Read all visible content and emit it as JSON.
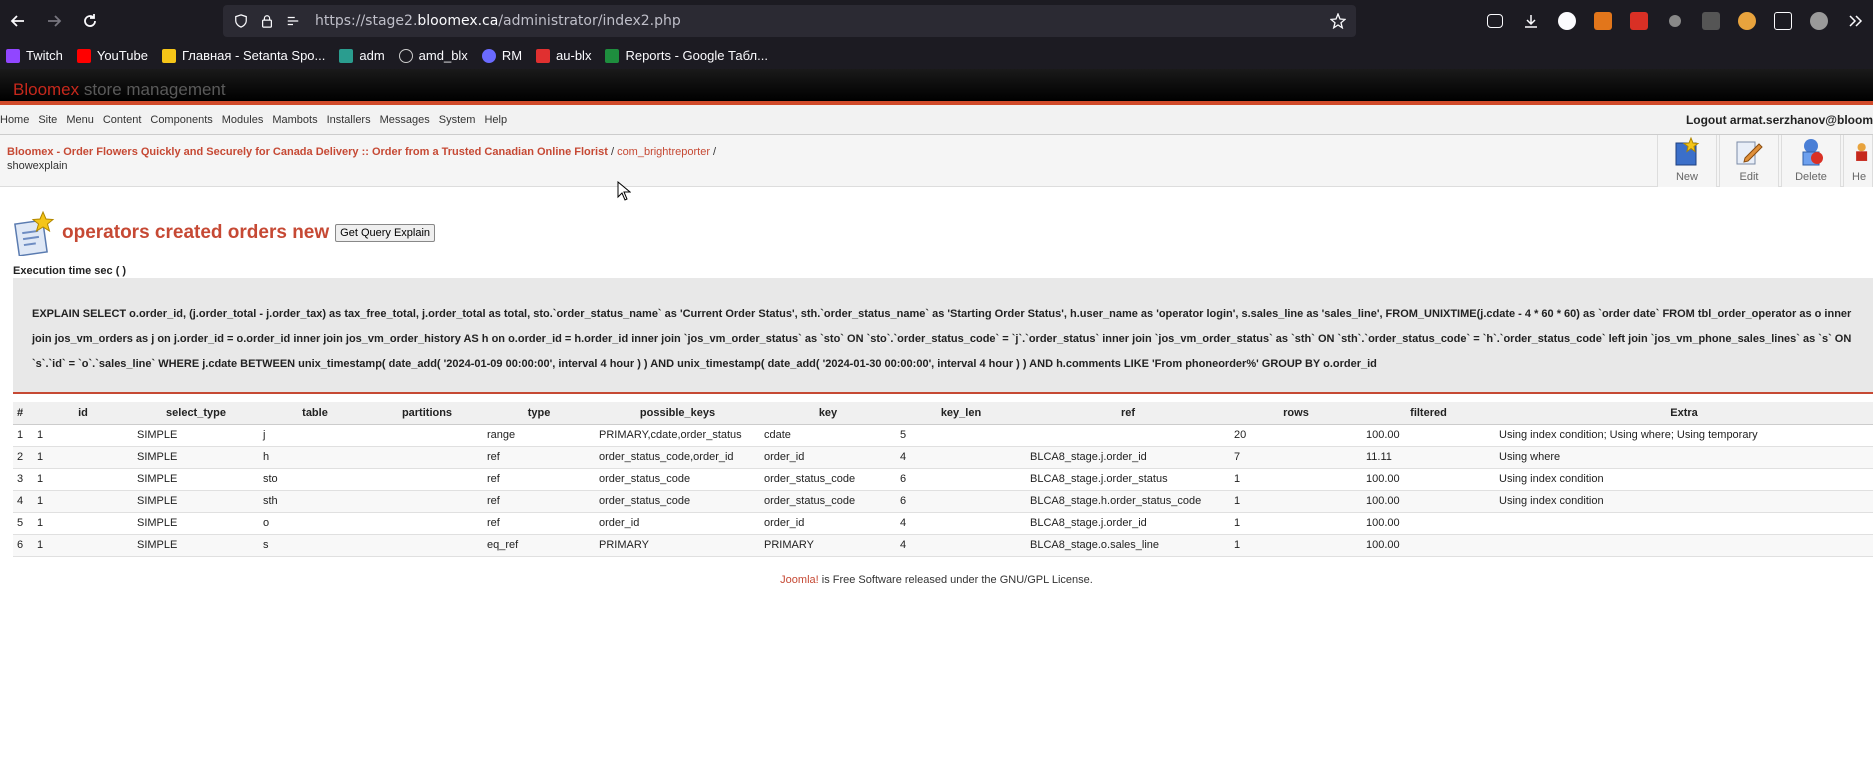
{
  "browser": {
    "url_prefix": "https://stage2.",
    "url_domain": "bloomex.ca",
    "url_path": "/administrator/index2.php",
    "bookmarks": [
      {
        "label": "Twitch",
        "color": "#9146ff"
      },
      {
        "label": "YouTube",
        "color": "#ff0000"
      },
      {
        "label": "Главная - Setanta Spo...",
        "color": "#f5c518"
      },
      {
        "label": "adm",
        "color": "#2a9d8f"
      },
      {
        "label": "amd_blx",
        "color": "#bbbbbb"
      },
      {
        "label": "RM",
        "color": "#6a6aff"
      },
      {
        "label": "au-blx",
        "color": "#e03030"
      },
      {
        "label": "Reports - Google Табл...",
        "color": "#1e8e3e"
      }
    ]
  },
  "header": {
    "logo_brand": "Bloomex",
    "logo_suffix": " store management"
  },
  "menu": {
    "items": [
      "Home",
      "Site",
      "Menu",
      "Content",
      "Components",
      "Modules",
      "Mambots",
      "Installers",
      "Messages",
      "System",
      "Help"
    ],
    "logout": "Logout armat.serzhanov@bloom"
  },
  "pathway": {
    "site_title": "Bloomex - Order Flowers Quickly and Securely for Canada Delivery :: Order from a Trusted Canadian Online Florist",
    "sep1": " / ",
    "component": "com_brightreporter",
    "sep2": " /",
    "task": "showexplain"
  },
  "toolbar": {
    "buttons": [
      "New",
      "Edit",
      "Delete",
      "He"
    ]
  },
  "page": {
    "title": "operators created orders new",
    "explain_button": "Get Query Explain",
    "execution_label": "Execution time sec ( )",
    "query": "EXPLAIN SELECT o.order_id, (j.order_total - j.order_tax) as tax_free_total, j.order_total as total, sto.`order_status_name` as 'Current Order Status', sth.`order_status_name` as 'Starting Order Status', h.user_name as 'operator login', s.sales_line as 'sales_line', FROM_UNIXTIME(j.cdate - 4 * 60 * 60) as `order date` FROM tbl_order_operator as o inner join jos_vm_orders as j on j.order_id = o.order_id inner join jos_vm_order_history AS h on o.order_id = h.order_id inner join `jos_vm_order_status` as `sto` ON `sto`.`order_status_code` = `j`.`order_status` inner join `jos_vm_order_status` as `sth` ON `sth`.`order_status_code` = `h`.`order_status_code` left join `jos_vm_phone_sales_lines` as `s` ON `s`.`id` = `o`.`sales_line` WHERE j.cdate BETWEEN unix_timestamp( date_add( '2024-01-09 00:00:00', interval 4 hour ) ) AND unix_timestamp( date_add( '2024-01-30 00:00:00', interval 4 hour ) ) AND h.comments LIKE 'From phoneorder%' GROUP BY o.order_id"
  },
  "table": {
    "headers": [
      "#",
      "id",
      "select_type",
      "table",
      "partitions",
      "type",
      "possible_keys",
      "key",
      "key_len",
      "ref",
      "rows",
      "filtered",
      "Extra"
    ],
    "rows": [
      [
        "1",
        "1",
        "SIMPLE",
        "j",
        "",
        "range",
        "PRIMARY,cdate,order_status",
        "cdate",
        "5",
        "",
        "20",
        "100.00",
        "Using index condition; Using where; Using temporary"
      ],
      [
        "2",
        "1",
        "SIMPLE",
        "h",
        "",
        "ref",
        "order_status_code,order_id",
        "order_id",
        "4",
        "BLCA8_stage.j.order_id",
        "7",
        "11.11",
        "Using where"
      ],
      [
        "3",
        "1",
        "SIMPLE",
        "sto",
        "",
        "ref",
        "order_status_code",
        "order_status_code",
        "6",
        "BLCA8_stage.j.order_status",
        "1",
        "100.00",
        "Using index condition"
      ],
      [
        "4",
        "1",
        "SIMPLE",
        "sth",
        "",
        "ref",
        "order_status_code",
        "order_status_code",
        "6",
        "BLCA8_stage.h.order_status_code",
        "1",
        "100.00",
        "Using index condition"
      ],
      [
        "5",
        "1",
        "SIMPLE",
        "o",
        "",
        "ref",
        "order_id",
        "order_id",
        "4",
        "BLCA8_stage.j.order_id",
        "1",
        "100.00",
        ""
      ],
      [
        "6",
        "1",
        "SIMPLE",
        "s",
        "",
        "eq_ref",
        "PRIMARY",
        "PRIMARY",
        "4",
        "BLCA8_stage.o.sales_line",
        "1",
        "100.00",
        ""
      ]
    ]
  },
  "footer": {
    "joomla": "Joomla!",
    "text": " is Free Software released under the GNU/GPL License."
  }
}
